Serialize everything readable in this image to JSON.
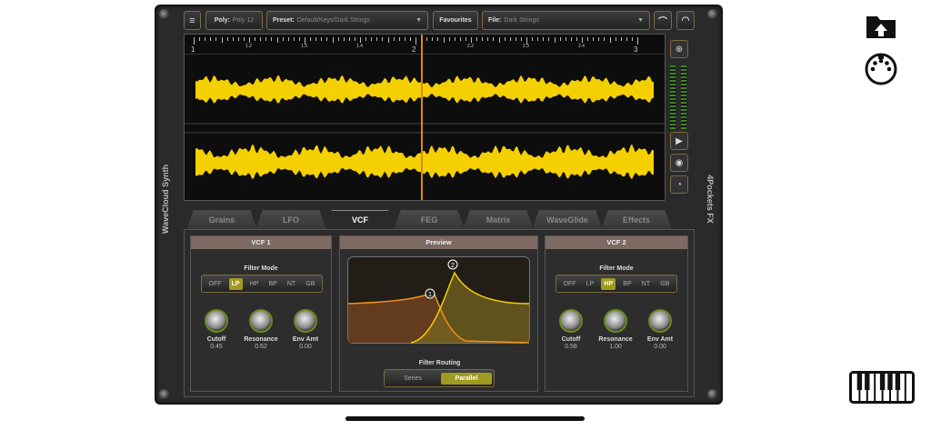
{
  "app": {
    "left_title": "WaveCloud Synth",
    "right_title": "4Pockets FX"
  },
  "toolbar": {
    "poly_label": "Poly:",
    "poly_value": "Poly 12",
    "preset_label": "Preset:",
    "preset_value": "Default/Keys/Dark Strings",
    "favourites": "Favourites",
    "file_label": "File:",
    "file_value": "Dark Strings"
  },
  "timeline": {
    "ticks": [
      "1",
      "1.2",
      "1.3",
      "1.4",
      "2",
      "2.2",
      "2.3",
      "2.4",
      "3"
    ]
  },
  "tabs": [
    "Grains",
    "LFO",
    "VCF",
    "FEG",
    "Matrix",
    "WaveGlide",
    "Effects"
  ],
  "active_tab": "VCF",
  "vcf1": {
    "title": "VCF 1",
    "filter_mode_label": "Filter Mode",
    "modes": [
      "OFF",
      "LP",
      "HP",
      "BP",
      "NT",
      "GB"
    ],
    "selected": "LP",
    "knobs": [
      {
        "label": "Cutoff",
        "value": "0.45"
      },
      {
        "label": "Resonance",
        "value": "0.62"
      },
      {
        "label": "Env Amt",
        "value": "0.00"
      }
    ]
  },
  "vcf2": {
    "title": "VCF 2",
    "filter_mode_label": "Filter Mode",
    "modes": [
      "OFF",
      "LP",
      "HP",
      "BP",
      "NT",
      "GB"
    ],
    "selected": "HP",
    "knobs": [
      {
        "label": "Cutoff",
        "value": "0.58"
      },
      {
        "label": "Resonance",
        "value": "1.00"
      },
      {
        "label": "Env Amt",
        "value": "0.00"
      }
    ]
  },
  "preview": {
    "title": "Preview",
    "marker1": "1",
    "marker2": "2",
    "routing_label": "Filter Routing",
    "routing_options": [
      "Series",
      "Parallel"
    ],
    "routing_selected": "Parallel"
  },
  "colors": {
    "accent": "#a09a20",
    "wave": "#f5d000",
    "playhead": "#e08a00"
  }
}
